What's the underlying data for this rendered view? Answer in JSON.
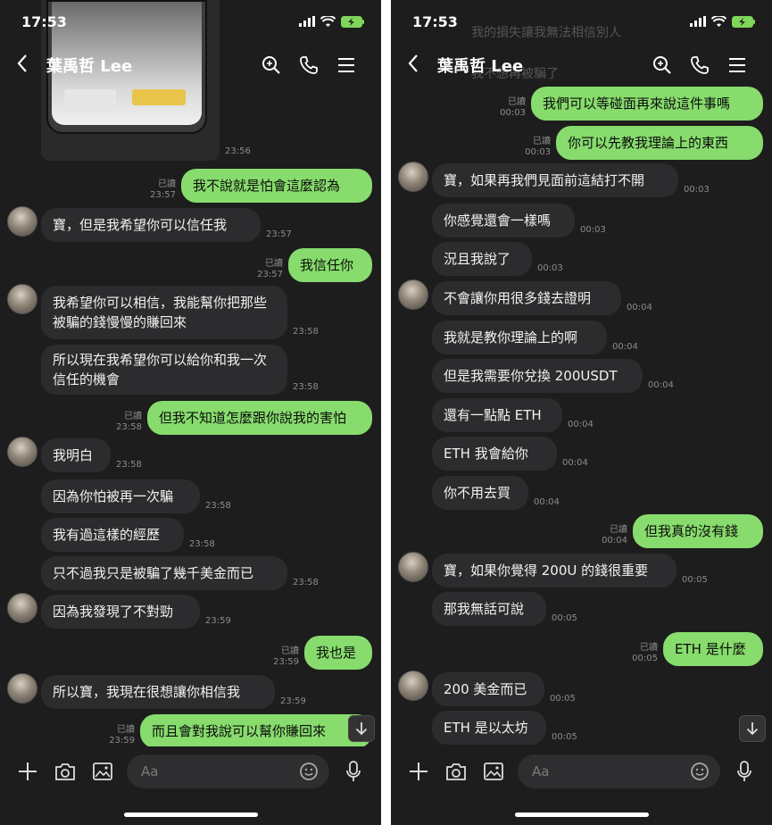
{
  "status": {
    "time": "17:53"
  },
  "header": {
    "contact_name": "葉禹哲 Lee"
  },
  "input": {
    "placeholder": "Aa"
  },
  "read_label": "已讀",
  "left": {
    "messages": [
      {
        "dir": "in",
        "text": "",
        "time": "23:56"
      },
      {
        "dir": "out",
        "text": "我不說就是怕會這麼認為",
        "time": "23:57",
        "read": true
      },
      {
        "dir": "in",
        "text": "寶，但是我希望你可以信任我",
        "time": "23:57"
      },
      {
        "dir": "out",
        "text": "我信任你",
        "time": "23:57",
        "read": true
      },
      {
        "dir": "in",
        "text": "我希望你可以相信，我能幫你把那些被騙的錢慢慢的賺回來",
        "time": "23:58"
      },
      {
        "dir": "in",
        "text": "所以現在我希望你可以給你和我一次信任的機會",
        "time": "23:58"
      },
      {
        "dir": "out",
        "text": "但我不知道怎麼跟你說我的害怕",
        "time": "23:58",
        "read": true
      },
      {
        "dir": "in",
        "text": "我明白",
        "time": "23:58"
      },
      {
        "dir": "in",
        "text": "因為你怕被再一次騙",
        "time": "23:58"
      },
      {
        "dir": "in",
        "text": "我有過這樣的經歷",
        "time": "23:58"
      },
      {
        "dir": "in",
        "text": "只不過我只是被騙了幾千美金而已",
        "time": "23:58"
      },
      {
        "dir": "in",
        "text": "因為我發現了不對勁",
        "time": "23:59"
      },
      {
        "dir": "out",
        "text": "我也是",
        "time": "23:59",
        "read": true
      },
      {
        "dir": "in",
        "text": "所以寶，我現在很想讓你相信我",
        "time": "23:59"
      },
      {
        "dir": "out",
        "text": "而且會對我說可以幫你賺回來",
        "time": "23:59",
        "read": true
      }
    ]
  },
  "right": {
    "ghost_lines": [
      "我的損失讓我無法相信別人",
      "我不想再被騙了"
    ],
    "messages": [
      {
        "dir": "out",
        "text": "我們可以等碰面再來說這件事嗎",
        "time": "00:03",
        "read": true
      },
      {
        "dir": "out",
        "text": "你可以先教我理論上的東西",
        "time": "00:03",
        "read": true
      },
      {
        "dir": "in",
        "text": "寶，如果再我們見面前這結打不開",
        "time": "00:03"
      },
      {
        "dir": "in",
        "text": "你感覺還會一樣嗎",
        "time": "00:03"
      },
      {
        "dir": "in",
        "text": "況且我說了",
        "time": "00:03"
      },
      {
        "dir": "in",
        "text": "不會讓你用很多錢去證明",
        "time": "00:04"
      },
      {
        "dir": "in",
        "text": "我就是教你理論上的啊",
        "time": "00:04"
      },
      {
        "dir": "in",
        "text": "但是我需要你兌換 200USDT",
        "time": "00:04"
      },
      {
        "dir": "in",
        "text": "還有一點點 ETH",
        "time": "00:04"
      },
      {
        "dir": "in",
        "text": "ETH 我會給你",
        "time": "00:04"
      },
      {
        "dir": "in",
        "text": "你不用去買",
        "time": "00:04"
      },
      {
        "dir": "out",
        "text": "但我真的沒有錢",
        "time": "00:04",
        "read": true
      },
      {
        "dir": "in",
        "text": "寶，如果你覺得 200U 的錢很重要",
        "time": "00:05"
      },
      {
        "dir": "in",
        "text": "那我無話可說",
        "time": "00:05"
      },
      {
        "dir": "out",
        "text": "ETH 是什麼",
        "time": "00:05",
        "read": true
      },
      {
        "dir": "in",
        "text": "200 美金而已",
        "time": "00:05"
      },
      {
        "dir": "in",
        "text": "ETH 是以太坊",
        "time": "00:05"
      }
    ]
  }
}
